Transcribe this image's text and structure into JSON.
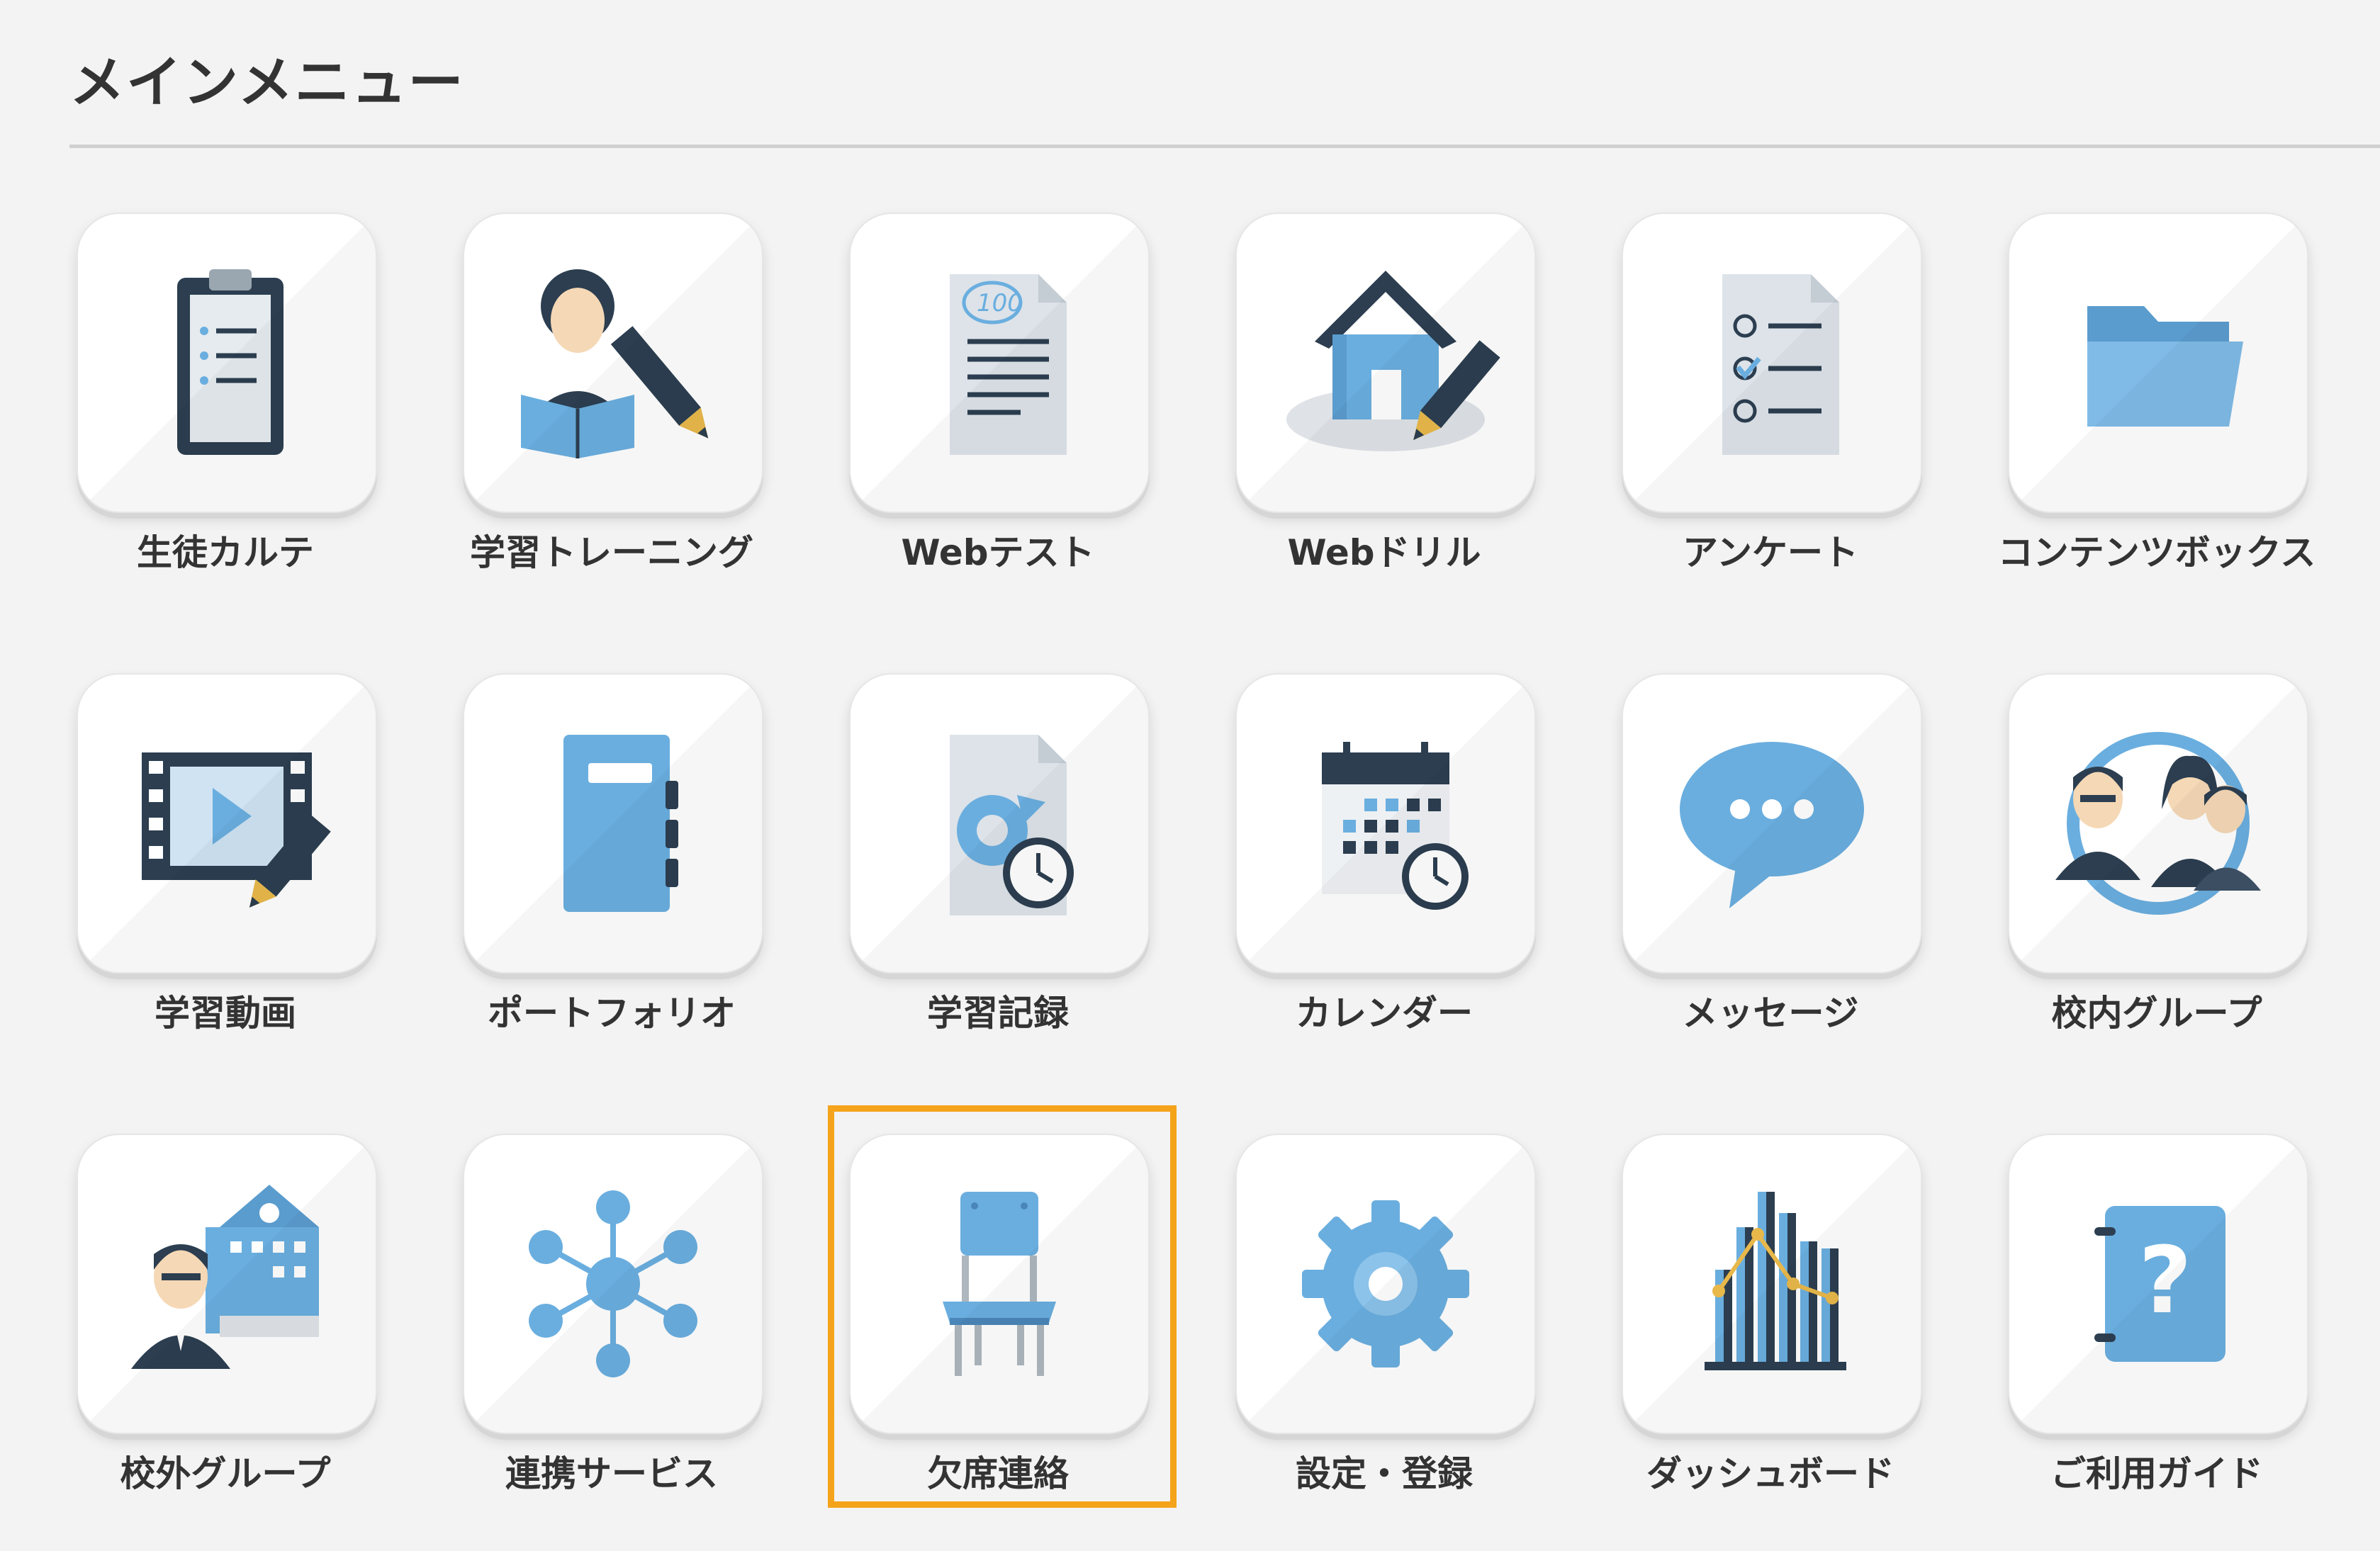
{
  "page": {
    "title": "メインメニュー"
  },
  "menu": {
    "items": [
      {
        "label": "生徒カルテ",
        "icon": "clipboard-icon"
      },
      {
        "label": "学習トレーニング",
        "icon": "student-study-icon"
      },
      {
        "label": "Webテスト",
        "icon": "test-paper-icon"
      },
      {
        "label": "Webドリル",
        "icon": "house-pencil-icon"
      },
      {
        "label": "アンケート",
        "icon": "survey-checklist-icon"
      },
      {
        "label": "コンテンツボックス",
        "icon": "folder-icon"
      },
      {
        "label": "学習動画",
        "icon": "video-film-icon"
      },
      {
        "label": "ポートフォリオ",
        "icon": "notebook-icon"
      },
      {
        "label": "学習記録",
        "icon": "history-record-icon"
      },
      {
        "label": "カレンダー",
        "icon": "calendar-clock-icon"
      },
      {
        "label": "メッセージ",
        "icon": "chat-bubble-icon"
      },
      {
        "label": "校内グループ",
        "icon": "group-people-icon"
      },
      {
        "label": "校外グループ",
        "icon": "school-building-person-icon"
      },
      {
        "label": "連携サービス",
        "icon": "network-hub-icon"
      },
      {
        "label": "欠席連絡",
        "icon": "chair-icon"
      },
      {
        "label": "設定・登録",
        "icon": "gear-icon"
      },
      {
        "label": "ダッシュボード",
        "icon": "bar-chart-icon"
      },
      {
        "label": "ご利用ガイド",
        "icon": "help-book-icon"
      }
    ]
  },
  "selection": {
    "highlighted_label": "欠席連絡"
  },
  "colors": {
    "accent_blue": "#6aaedf",
    "dark_navy": "#2c3e50",
    "highlight_border": "#f5a31a"
  }
}
